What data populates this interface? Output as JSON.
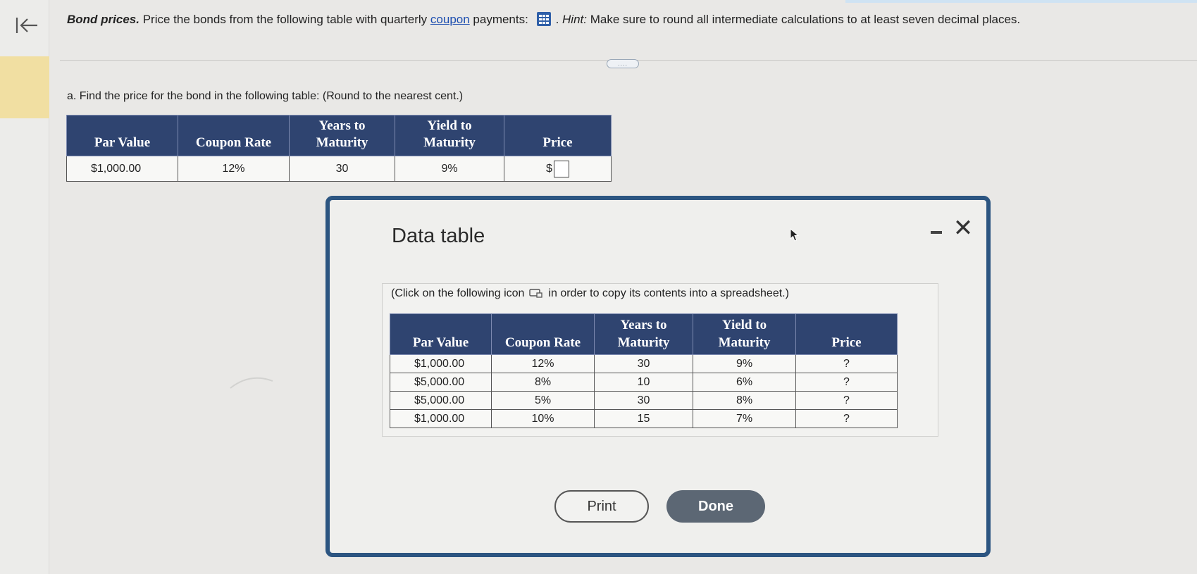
{
  "question": {
    "title": "Bond prices.",
    "text_before_link": " Price the bonds from the following table with quarterly ",
    "link": "coupon",
    "text_after_link": " payments: ",
    "after_icon": ". ",
    "hint_label": "Hint:",
    "hint_text": " Make sure to round all intermediate calculations to at least seven decimal places."
  },
  "more_button": "....",
  "part_a": {
    "prompt": "a. Find the price for the bond in the following table:  (Round to the nearest cent.)",
    "headers": [
      "Par Value",
      "Coupon Rate",
      "Years to Maturity",
      "Yield to Maturity",
      "Price"
    ],
    "row": {
      "par": "$1,000.00",
      "coupon": "12%",
      "years": "30",
      "yield": "9%",
      "price_prefix": "$"
    }
  },
  "modal": {
    "title": "Data table",
    "instruction_before": "(Click on the following icon",
    "instruction_after": "in order to copy its contents into a spreadsheet.)",
    "headers": [
      "Par Value",
      "Coupon Rate",
      "Years to Maturity",
      "Yield to Maturity",
      "Price"
    ],
    "rows": [
      [
        "$1,000.00",
        "12%",
        "30",
        "9%",
        "?"
      ],
      [
        "$5,000.00",
        "8%",
        "10",
        "6%",
        "?"
      ],
      [
        "$5,000.00",
        "5%",
        "30",
        "8%",
        "?"
      ],
      [
        "$1,000.00",
        "10%",
        "15",
        "7%",
        "?"
      ]
    ],
    "print_label": "Print",
    "done_label": "Done",
    "close_symbol": "✕"
  },
  "colors": {
    "header_bg": "#2f4470",
    "modal_border": "#2c5581",
    "done_bg": "#5c6774",
    "link": "#1e4fb0",
    "accent_strip": "#f1dfa2"
  },
  "icons": [
    "back-to-start-icon",
    "data-grid-icon",
    "copy-spreadsheet-icon",
    "minimize-icon",
    "close-icon",
    "mouse-cursor-icon"
  ]
}
